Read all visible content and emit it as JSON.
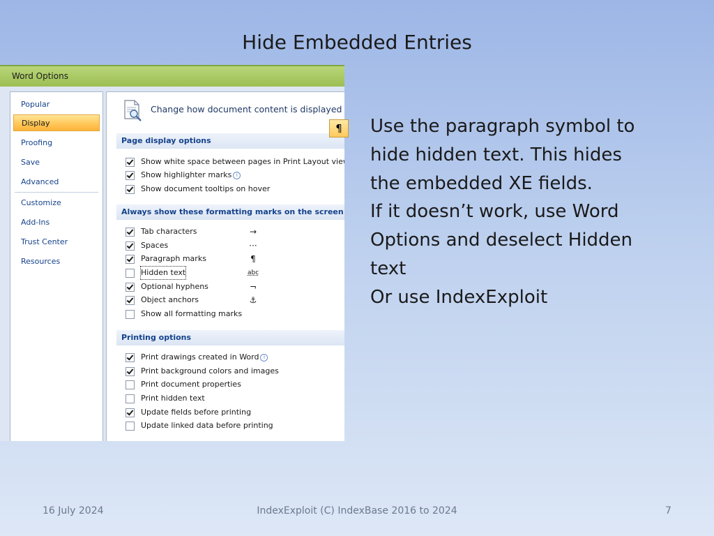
{
  "slide": {
    "title": "Hide Embedded Entries",
    "body_lines": [
      "Use the paragraph symbol to",
      "hide hidden text. This hides",
      "the embedded XE fields.",
      "If it doesn’t work, use Word",
      "Options and deselect Hidden",
      "text",
      "Or use IndexExploit"
    ],
    "footer": {
      "date": "16 July 2024",
      "center": "IndexExploit (C) IndexBase 2016 to 2024",
      "page": "7"
    }
  },
  "window": {
    "title": "Word Options",
    "sidebar": {
      "items": [
        "Popular",
        "Display",
        "Proofing",
        "Save",
        "Advanced",
        "Customize",
        "Add-Ins",
        "Trust Center",
        "Resources"
      ],
      "selected": "Display"
    },
    "banner": {
      "text": "Change how document content is displayed on",
      "icon": "document-magnifier-icon"
    },
    "paragraph_button": {
      "symbol": "¶"
    },
    "sections": [
      {
        "heading": "Page display options",
        "options": [
          {
            "label": "Show white space between pages in Print Layout view",
            "checked": true,
            "info": true
          },
          {
            "label": "Show highlighter marks",
            "checked": true,
            "info": true
          },
          {
            "label": "Show document tooltips on hover",
            "checked": true,
            "info": false
          }
        ]
      },
      {
        "heading": "Always show these formatting marks on the screen",
        "options": [
          {
            "label": "Tab characters",
            "checked": true,
            "symbol": "→"
          },
          {
            "label": "Spaces",
            "checked": true,
            "symbol": "···"
          },
          {
            "label": "Paragraph marks",
            "checked": true,
            "symbol": "¶"
          },
          {
            "label": "Hidden text",
            "checked": false,
            "symbol": "abc"
          },
          {
            "label": "Optional hyphens",
            "checked": true,
            "symbol": "¬"
          },
          {
            "label": "Object anchors",
            "checked": true,
            "symbol": "⚓"
          },
          {
            "label": "Show all formatting marks",
            "checked": false,
            "symbol": ""
          }
        ]
      },
      {
        "heading": "Printing options",
        "options": [
          {
            "label": "Print drawings created in Word",
            "checked": true,
            "info": true
          },
          {
            "label": "Print background colors and images",
            "checked": true
          },
          {
            "label": "Print document properties",
            "checked": false
          },
          {
            "label": "Print hidden text",
            "checked": false
          },
          {
            "label": "Update fields before printing",
            "checked": true
          },
          {
            "label": "Update linked data before printing",
            "checked": false
          }
        ]
      }
    ]
  }
}
